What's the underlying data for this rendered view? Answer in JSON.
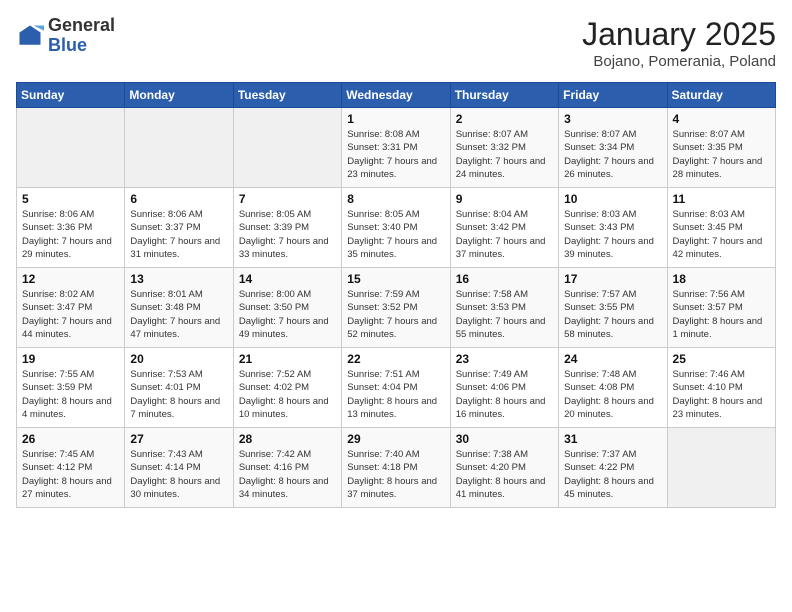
{
  "header": {
    "logo": {
      "line1": "General",
      "line2": "Blue"
    },
    "title": "January 2025",
    "subtitle": "Bojano, Pomerania, Poland"
  },
  "weekdays": [
    "Sunday",
    "Monday",
    "Tuesday",
    "Wednesday",
    "Thursday",
    "Friday",
    "Saturday"
  ],
  "weeks": [
    [
      {
        "num": "",
        "info": ""
      },
      {
        "num": "",
        "info": ""
      },
      {
        "num": "",
        "info": ""
      },
      {
        "num": "1",
        "info": "Sunrise: 8:08 AM\nSunset: 3:31 PM\nDaylight: 7 hours and 23 minutes."
      },
      {
        "num": "2",
        "info": "Sunrise: 8:07 AM\nSunset: 3:32 PM\nDaylight: 7 hours and 24 minutes."
      },
      {
        "num": "3",
        "info": "Sunrise: 8:07 AM\nSunset: 3:34 PM\nDaylight: 7 hours and 26 minutes."
      },
      {
        "num": "4",
        "info": "Sunrise: 8:07 AM\nSunset: 3:35 PM\nDaylight: 7 hours and 28 minutes."
      }
    ],
    [
      {
        "num": "5",
        "info": "Sunrise: 8:06 AM\nSunset: 3:36 PM\nDaylight: 7 hours and 29 minutes."
      },
      {
        "num": "6",
        "info": "Sunrise: 8:06 AM\nSunset: 3:37 PM\nDaylight: 7 hours and 31 minutes."
      },
      {
        "num": "7",
        "info": "Sunrise: 8:05 AM\nSunset: 3:39 PM\nDaylight: 7 hours and 33 minutes."
      },
      {
        "num": "8",
        "info": "Sunrise: 8:05 AM\nSunset: 3:40 PM\nDaylight: 7 hours and 35 minutes."
      },
      {
        "num": "9",
        "info": "Sunrise: 8:04 AM\nSunset: 3:42 PM\nDaylight: 7 hours and 37 minutes."
      },
      {
        "num": "10",
        "info": "Sunrise: 8:03 AM\nSunset: 3:43 PM\nDaylight: 7 hours and 39 minutes."
      },
      {
        "num": "11",
        "info": "Sunrise: 8:03 AM\nSunset: 3:45 PM\nDaylight: 7 hours and 42 minutes."
      }
    ],
    [
      {
        "num": "12",
        "info": "Sunrise: 8:02 AM\nSunset: 3:47 PM\nDaylight: 7 hours and 44 minutes."
      },
      {
        "num": "13",
        "info": "Sunrise: 8:01 AM\nSunset: 3:48 PM\nDaylight: 7 hours and 47 minutes."
      },
      {
        "num": "14",
        "info": "Sunrise: 8:00 AM\nSunset: 3:50 PM\nDaylight: 7 hours and 49 minutes."
      },
      {
        "num": "15",
        "info": "Sunrise: 7:59 AM\nSunset: 3:52 PM\nDaylight: 7 hours and 52 minutes."
      },
      {
        "num": "16",
        "info": "Sunrise: 7:58 AM\nSunset: 3:53 PM\nDaylight: 7 hours and 55 minutes."
      },
      {
        "num": "17",
        "info": "Sunrise: 7:57 AM\nSunset: 3:55 PM\nDaylight: 7 hours and 58 minutes."
      },
      {
        "num": "18",
        "info": "Sunrise: 7:56 AM\nSunset: 3:57 PM\nDaylight: 8 hours and 1 minute."
      }
    ],
    [
      {
        "num": "19",
        "info": "Sunrise: 7:55 AM\nSunset: 3:59 PM\nDaylight: 8 hours and 4 minutes."
      },
      {
        "num": "20",
        "info": "Sunrise: 7:53 AM\nSunset: 4:01 PM\nDaylight: 8 hours and 7 minutes."
      },
      {
        "num": "21",
        "info": "Sunrise: 7:52 AM\nSunset: 4:02 PM\nDaylight: 8 hours and 10 minutes."
      },
      {
        "num": "22",
        "info": "Sunrise: 7:51 AM\nSunset: 4:04 PM\nDaylight: 8 hours and 13 minutes."
      },
      {
        "num": "23",
        "info": "Sunrise: 7:49 AM\nSunset: 4:06 PM\nDaylight: 8 hours and 16 minutes."
      },
      {
        "num": "24",
        "info": "Sunrise: 7:48 AM\nSunset: 4:08 PM\nDaylight: 8 hours and 20 minutes."
      },
      {
        "num": "25",
        "info": "Sunrise: 7:46 AM\nSunset: 4:10 PM\nDaylight: 8 hours and 23 minutes."
      }
    ],
    [
      {
        "num": "26",
        "info": "Sunrise: 7:45 AM\nSunset: 4:12 PM\nDaylight: 8 hours and 27 minutes."
      },
      {
        "num": "27",
        "info": "Sunrise: 7:43 AM\nSunset: 4:14 PM\nDaylight: 8 hours and 30 minutes."
      },
      {
        "num": "28",
        "info": "Sunrise: 7:42 AM\nSunset: 4:16 PM\nDaylight: 8 hours and 34 minutes."
      },
      {
        "num": "29",
        "info": "Sunrise: 7:40 AM\nSunset: 4:18 PM\nDaylight: 8 hours and 37 minutes."
      },
      {
        "num": "30",
        "info": "Sunrise: 7:38 AM\nSunset: 4:20 PM\nDaylight: 8 hours and 41 minutes."
      },
      {
        "num": "31",
        "info": "Sunrise: 7:37 AM\nSunset: 4:22 PM\nDaylight: 8 hours and 45 minutes."
      },
      {
        "num": "",
        "info": ""
      }
    ]
  ]
}
